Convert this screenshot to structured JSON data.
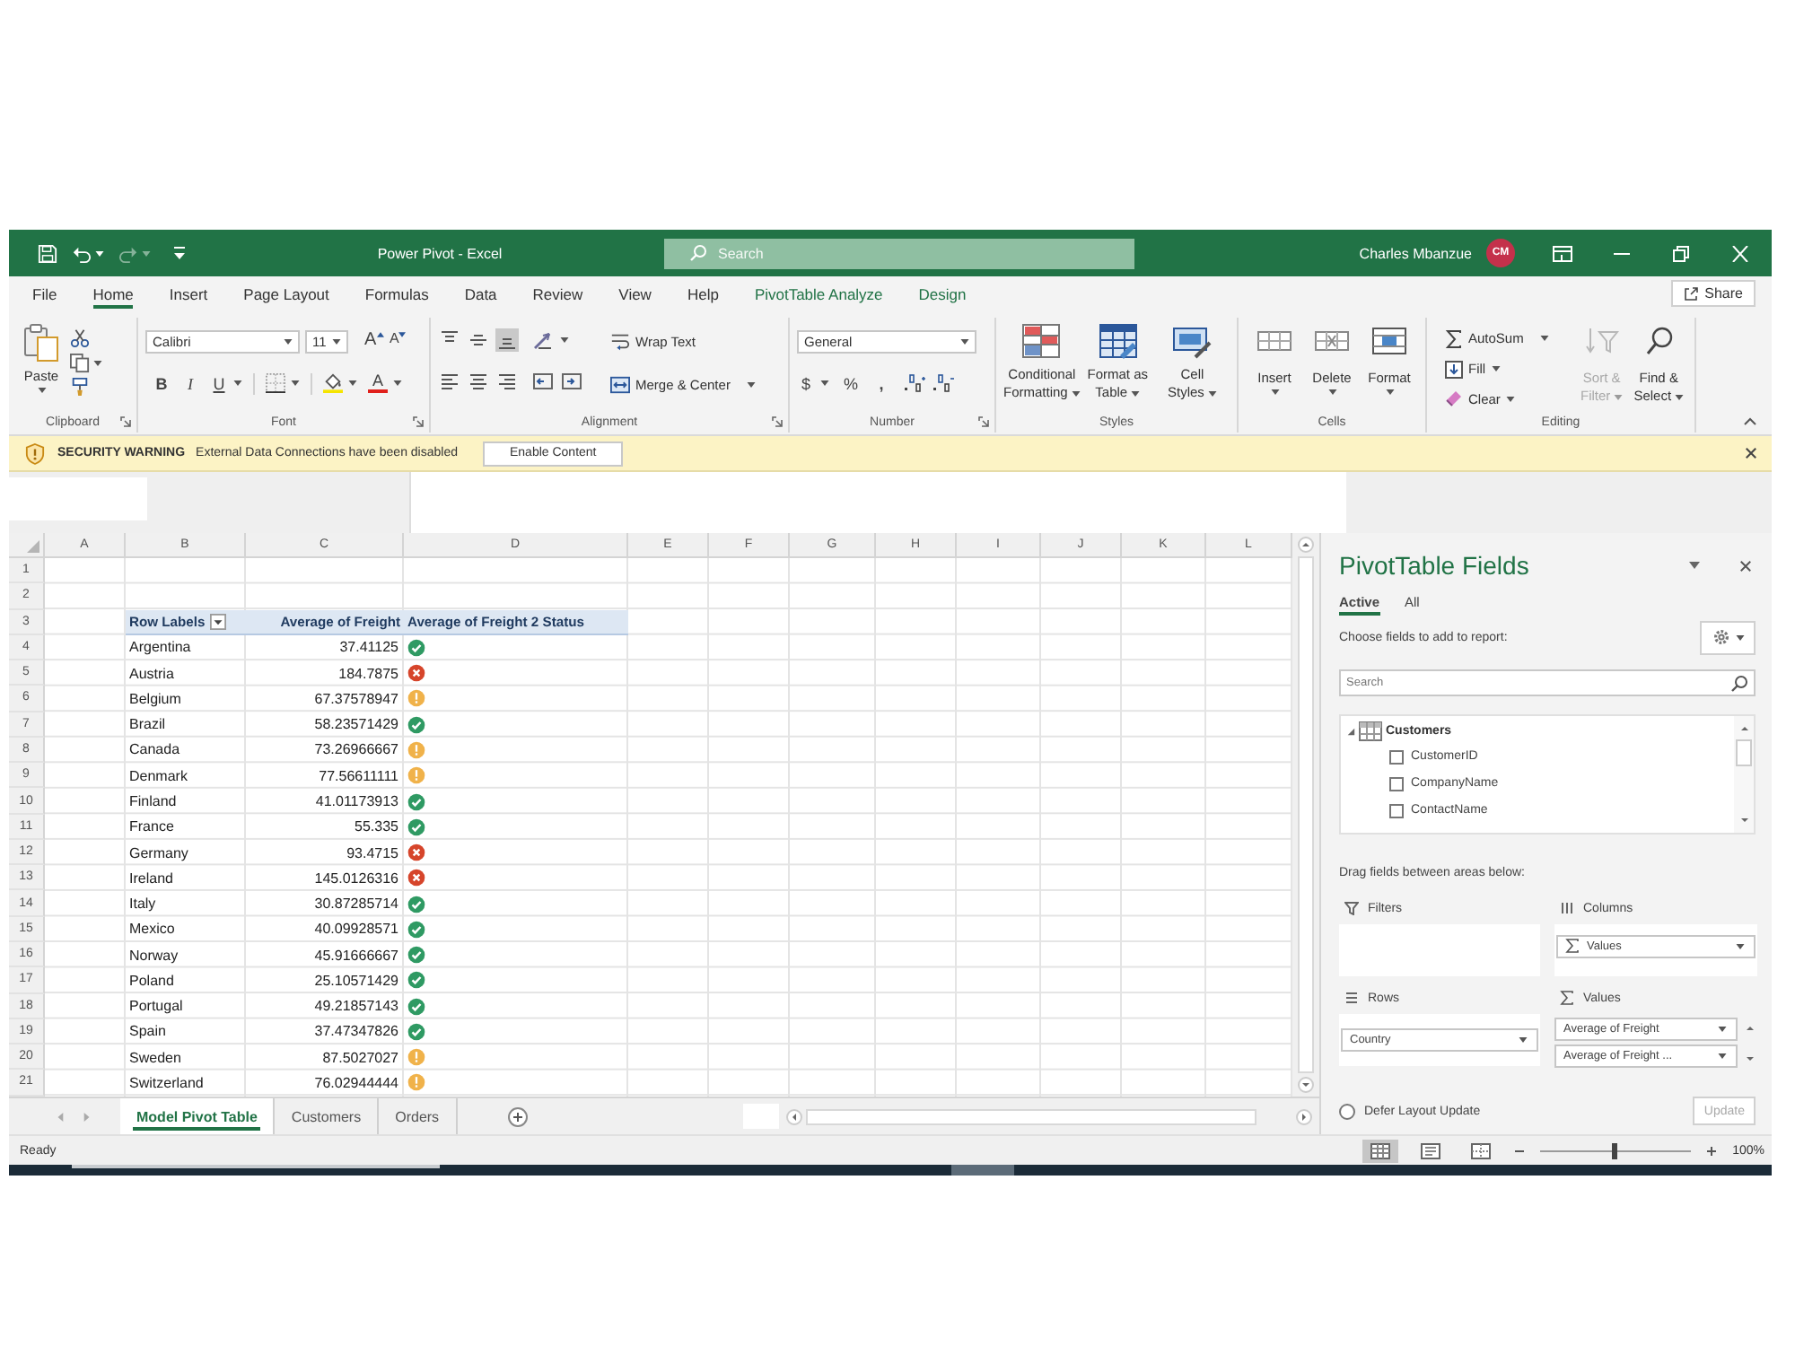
{
  "window": {
    "title": "Power Pivot - Excel",
    "search": {
      "placeholder": "Search"
    },
    "user_name": "Charles Mbanzue",
    "user_initials": "CM",
    "redo_disabled": true
  },
  "ribbon_tabs": [
    {
      "label": "File",
      "selected": false,
      "kind": "standard"
    },
    {
      "label": "Home",
      "selected": true,
      "kind": "standard"
    },
    {
      "label": "Insert",
      "selected": false,
      "kind": "standard"
    },
    {
      "label": "Page Layout",
      "selected": false,
      "kind": "standard"
    },
    {
      "label": "Formulas",
      "selected": false,
      "kind": "standard"
    },
    {
      "label": "Data",
      "selected": false,
      "kind": "standard"
    },
    {
      "label": "Review",
      "selected": false,
      "kind": "standard"
    },
    {
      "label": "View",
      "selected": false,
      "kind": "standard"
    },
    {
      "label": "Help",
      "selected": false,
      "kind": "standard"
    },
    {
      "label": "PivotTable Analyze",
      "selected": false,
      "kind": "contextual"
    },
    {
      "label": "Design",
      "selected": false,
      "kind": "contextual"
    }
  ],
  "share_button": "Share",
  "ribbon": {
    "clipboard": {
      "label": "Clipboard",
      "paste": "Paste"
    },
    "font": {
      "label": "Font",
      "font_name": "Calibri",
      "font_size": "11",
      "grow": "A",
      "shrink": "A",
      "bold": "B",
      "italic": "I",
      "underline": "U",
      "font_color": "A"
    },
    "alignment": {
      "label": "Alignment",
      "vertical": [
        {
          "selected": false
        },
        {
          "selected": false
        },
        {
          "selected": true
        }
      ],
      "wrap_text": "Wrap Text",
      "merge_center": "Merge & Center"
    },
    "number": {
      "label": "Number",
      "format": "General",
      "currency": "$",
      "percent": "%",
      "comma": ","
    },
    "styles": {
      "label": "Styles",
      "buttons": [
        {
          "lines": [
            "Conditional",
            "Formatting"
          ]
        },
        {
          "lines": [
            "Format as",
            "Table"
          ]
        },
        {
          "lines": [
            "Cell",
            "Styles"
          ]
        }
      ]
    },
    "cells": {
      "label": "Cells",
      "buttons": [
        "Insert",
        "Delete",
        "Format"
      ]
    },
    "editing": {
      "label": "Editing",
      "autosum": "AutoSum",
      "fill": "Fill",
      "clear": "Clear",
      "sort_filter": {
        "lines": [
          "Sort &",
          "Filter"
        ],
        "disabled": true
      },
      "find_select": {
        "lines": [
          "Find &",
          "Select"
        ],
        "disabled": false
      }
    }
  },
  "security_bar": {
    "title": "SECURITY WARNING",
    "message": "External Data Connections have been disabled",
    "button": "Enable Content"
  },
  "grid": {
    "columns": [
      "A",
      "B",
      "C",
      "D",
      "E",
      "F",
      "G",
      "H",
      "I",
      "J",
      "K",
      "L"
    ],
    "rows": [
      "1",
      "2",
      "3",
      "4",
      "5",
      "6",
      "7",
      "8",
      "9",
      "10",
      "11",
      "12",
      "13",
      "14",
      "15",
      "16",
      "17",
      "18",
      "19",
      "20",
      "21"
    ]
  },
  "pivot": {
    "headers": [
      "Row Labels",
      "Average of Freight",
      "Average of Freight 2 Status"
    ],
    "rows": [
      {
        "label": "Argentina",
        "value": "37.41125",
        "kind": "good"
      },
      {
        "label": "Austria",
        "value": "184.7875",
        "kind": "bad"
      },
      {
        "label": "Belgium",
        "value": "67.37578947",
        "kind": "neutral"
      },
      {
        "label": "Brazil",
        "value": "58.23571429",
        "kind": "good"
      },
      {
        "label": "Canada",
        "value": "73.26966667",
        "kind": "neutral"
      },
      {
        "label": "Denmark",
        "value": "77.56611111",
        "kind": "neutral"
      },
      {
        "label": "Finland",
        "value": "41.01173913",
        "kind": "good"
      },
      {
        "label": "France",
        "value": "55.335",
        "kind": "good"
      },
      {
        "label": "Germany",
        "value": "93.4715",
        "kind": "bad"
      },
      {
        "label": "Ireland",
        "value": "145.0126316",
        "kind": "bad"
      },
      {
        "label": "Italy",
        "value": "30.87285714",
        "kind": "good"
      },
      {
        "label": "Mexico",
        "value": "40.09928571",
        "kind": "good"
      },
      {
        "label": "Norway",
        "value": "45.91666667",
        "kind": "good"
      },
      {
        "label": "Poland",
        "value": "25.10571429",
        "kind": "good"
      },
      {
        "label": "Portugal",
        "value": "49.21857143",
        "kind": "good"
      },
      {
        "label": "Spain",
        "value": "37.47347826",
        "kind": "good"
      },
      {
        "label": "Sweden",
        "value": "87.5027027",
        "kind": "neutral"
      },
      {
        "label": "Switzerland",
        "value": "76.02944444",
        "kind": "neutral"
      }
    ]
  },
  "sheet_tabs": [
    {
      "label": "Model Pivot Table",
      "selected": true
    },
    {
      "label": "Customers",
      "selected": false
    },
    {
      "label": "Orders",
      "selected": false
    }
  ],
  "field_panel": {
    "title": "PivotTable Fields",
    "tabs": [
      {
        "label": "Active",
        "selected": true
      },
      {
        "label": "All",
        "selected": false
      }
    ],
    "instruction": "Choose fields to add to report:",
    "search": {
      "placeholder": "Search"
    },
    "tables": [
      {
        "label": "Customers",
        "expanded": true,
        "children": [
          {
            "label": "CustomerID",
            "checked": false
          },
          {
            "label": "CompanyName",
            "checked": false
          },
          {
            "label": "ContactName",
            "checked": false
          }
        ]
      }
    ],
    "areas_instruction": "Drag fields between areas below:",
    "areas": {
      "filters": {
        "label": "Filters"
      },
      "columns": {
        "label": "Columns",
        "items": [
          {
            "label": "Values",
            "kind": "values"
          }
        ]
      },
      "rows": {
        "label": "Rows",
        "items": [
          {
            "label": "Country",
            "kind": "field"
          }
        ]
      },
      "values": {
        "label": "Values",
        "items": [
          {
            "label": "Average of Freight",
            "kind": "field"
          },
          {
            "label": "Average of Freight ...",
            "kind": "field"
          }
        ]
      }
    },
    "defer": {
      "label": "Defer Layout Update",
      "checked": false
    },
    "update_button": {
      "label": "Update",
      "disabled": true
    }
  },
  "status_bar": {
    "status": "Ready",
    "views": [
      {
        "selected": true
      },
      {
        "selected": false
      },
      {
        "selected": false
      }
    ],
    "zoom": {
      "level": 0.5
    },
    "zoom_label": "100%"
  }
}
